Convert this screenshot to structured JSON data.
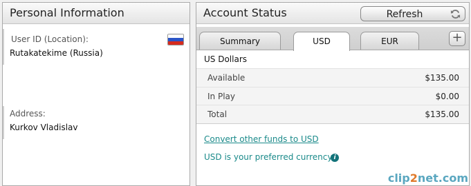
{
  "personal": {
    "title": "Personal Information",
    "user_id_label": "User ID (Location):",
    "user_id_value": "Rutakatekime (Russia)",
    "address_label": "Address:",
    "address_value": "Kurkov Vladislav"
  },
  "account": {
    "title": "Account Status",
    "refresh_label": "Refresh",
    "tabs": [
      {
        "label": "Summary"
      },
      {
        "label": "USD"
      },
      {
        "label": "EUR"
      }
    ],
    "add_tab_label": "+",
    "currency_title": "US Dollars",
    "rows": [
      {
        "label": "Available",
        "value": "$135.00"
      },
      {
        "label": "In Play",
        "value": "$0.00"
      },
      {
        "label": "Total",
        "value": "$135.00"
      }
    ],
    "convert_link": "Convert other funds to USD",
    "preferred_note": "USD is your preferred currency",
    "info_icon_glyph": "i"
  },
  "watermark": {
    "part1": "clip",
    "part2": "2",
    "part3": "net.com"
  },
  "colors": {
    "link": "#1a8a8a",
    "flag_white": "#ffffff",
    "flag_blue": "#2a55c8",
    "flag_red": "#d52b1e"
  },
  "icons": [
    "russia-flag-icon",
    "refresh-icon",
    "plus-icon",
    "info-icon"
  ]
}
